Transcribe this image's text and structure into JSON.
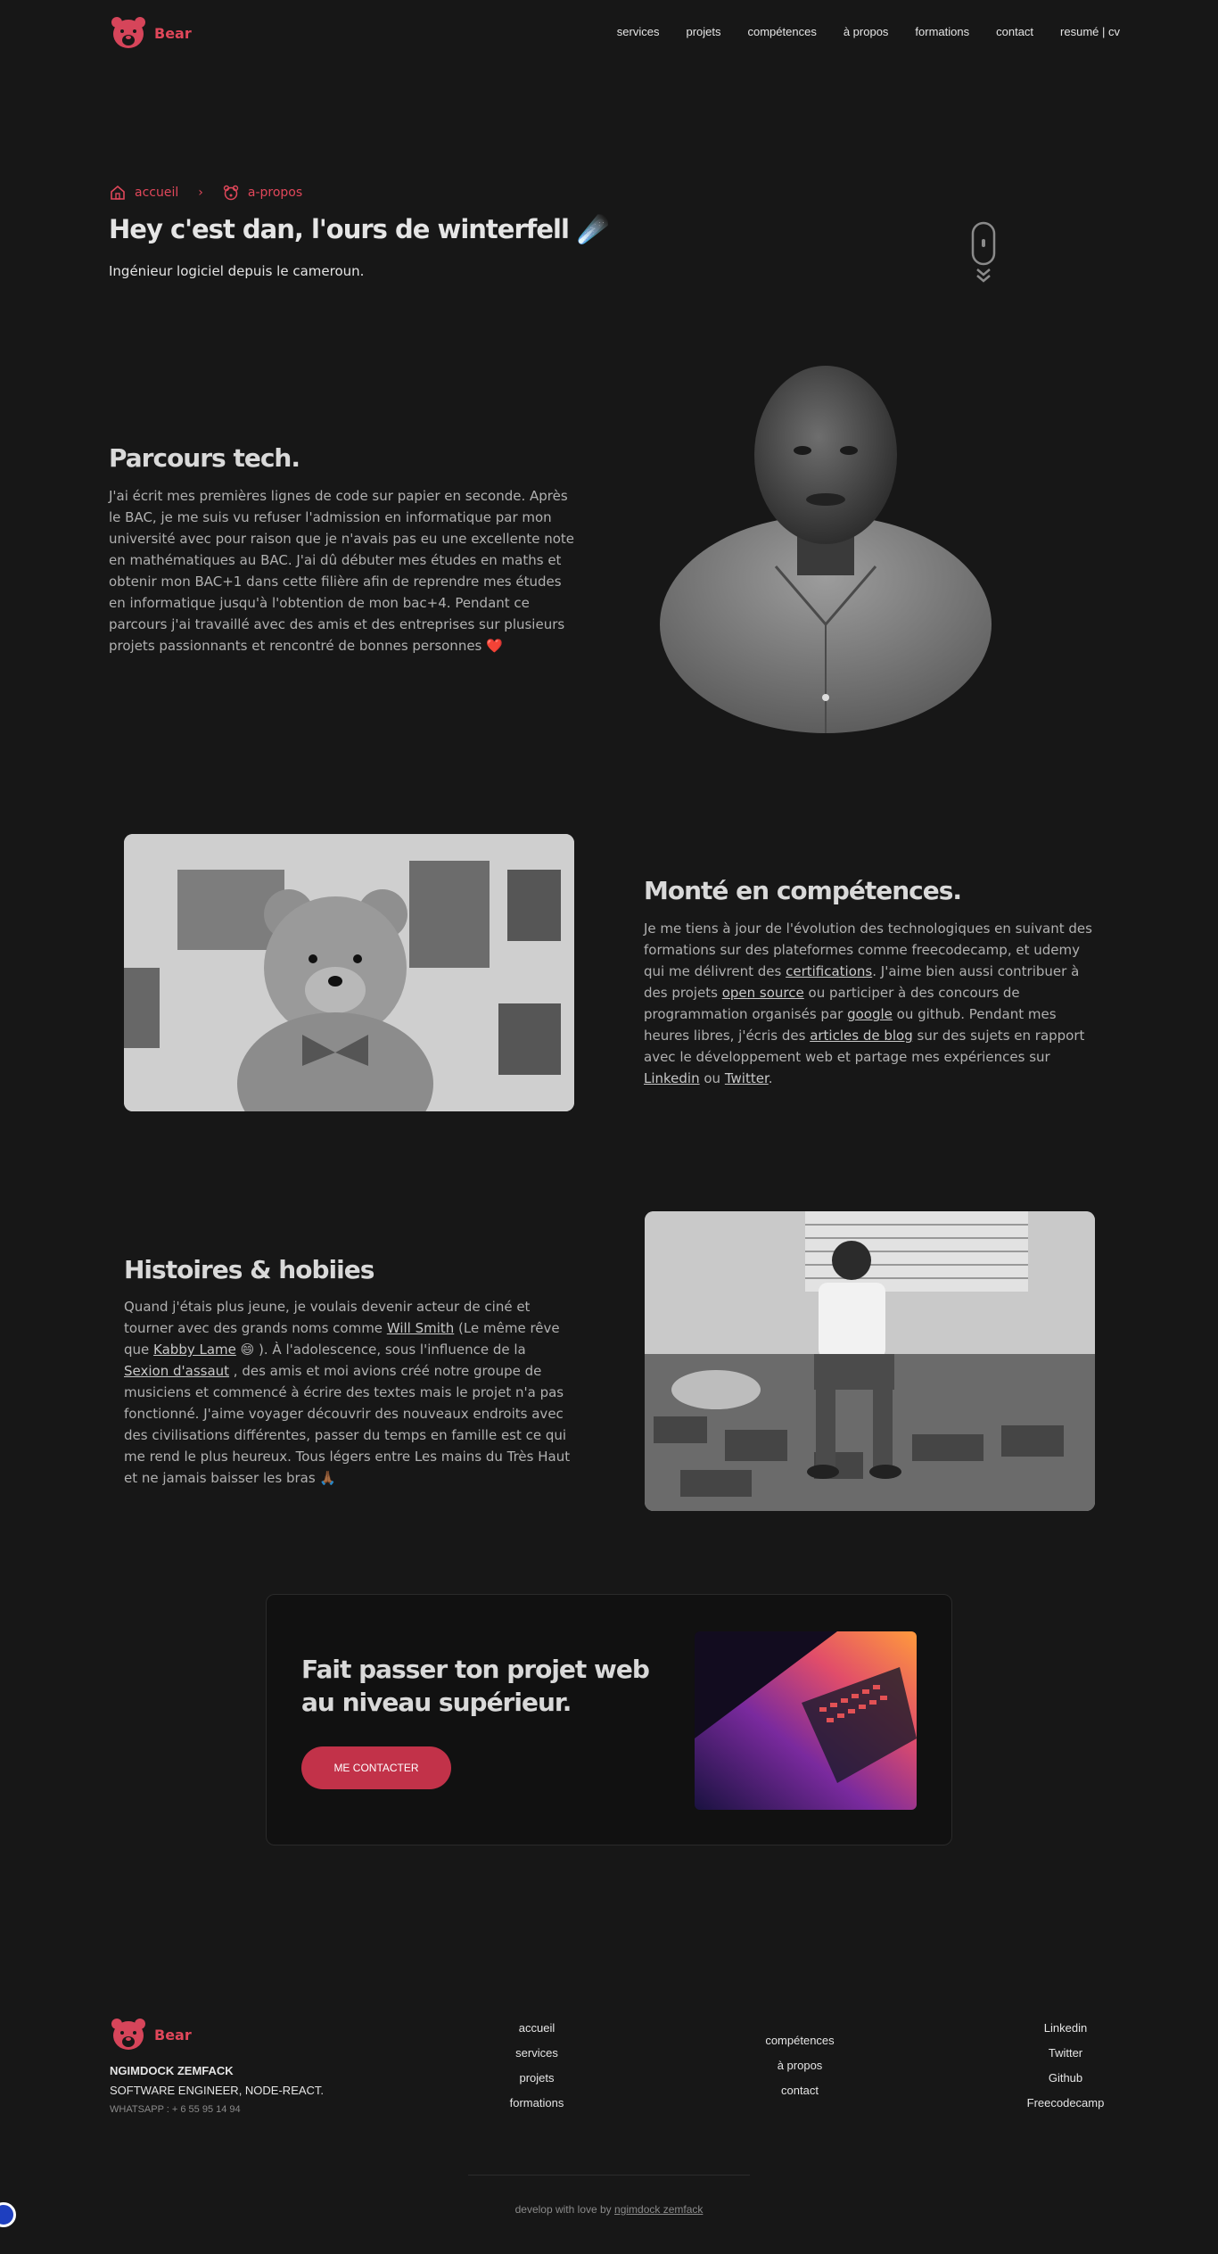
{
  "header": {
    "logo_text": "Bear",
    "nav": [
      "services",
      "projets",
      "compétences",
      "à propos",
      "formations",
      "contact",
      "resumé | cv"
    ]
  },
  "breadcrumb": {
    "home": "accueil",
    "separator": "›",
    "current": "a-propos"
  },
  "hero": {
    "title": "Hey c'est dan, l'ours de winterfell ☄️",
    "subtitle": "Ingénieur logiciel depuis le cameroun."
  },
  "section1": {
    "title": "Parcours tech.",
    "text": "J'ai écrit mes premières lignes de code sur papier en seconde. Après le BAC, je me suis vu refuser l'admission en informatique par mon université avec pour raison que je n'avais pas eu une excellente note en mathématiques au BAC. J'ai dû débuter mes études en maths et obtenir mon BAC+1 dans cette filière afin de reprendre mes études en informatique jusqu'à l'obtention de mon bac+4. Pendant ce parcours j'ai travaillé avec des amis et des entreprises sur plusieurs projets passionnants et rencontré de bonnes personnes ❤️"
  },
  "section2": {
    "title": "Monté en compétences.",
    "t1": "Je me tiens à jour de l'évolution des technologiques en suivant des formations sur des plateformes comme freecodecamp, et udemy qui me délivrent des ",
    "l1": "certifications",
    "t2": ". J'aime bien aussi contribuer à des projets ",
    "l2": "open source",
    "t3": " ou participer à des concours de programmation organisés par ",
    "l3": "google",
    "t4": " ou github. Pendant mes heures libres, j'écris des ",
    "l4": "articles de blog",
    "t5": " sur des sujets en rapport avec le développement web et partage mes expériences sur ",
    "l5": "Linkedin",
    "t6": " ou ",
    "l6": "Twitter",
    "t7": "."
  },
  "section3": {
    "title": "Histoires & hobiies",
    "t1": "Quand j'étais plus jeune, je voulais devenir acteur de ciné et tourner avec des grands noms comme ",
    "l1": "Will Smith",
    "t2": " (Le même rêve que ",
    "l2": "Kabby Lame",
    "t3": " 😄 ). À l'adolescence, sous l'influence de la ",
    "l3": "Sexion d'assaut",
    "t4": " , des amis et moi avions créé notre groupe de musiciens et commencé à écrire des textes mais le projet n'a pas fonctionné. J'aime voyager découvrir des nouveaux endroits avec des civilisations différentes, passer du temps en famille est ce qui me rend le plus heureux. Tous légers entre Les mains du Très Haut et ne jamais baisser les bras 🙏🏾"
  },
  "cta": {
    "title": "Fait passer ton projet web au niveau supérieur.",
    "button": "ME CONTACTER"
  },
  "footer": {
    "logo_text": "Bear",
    "name": "NGIMDOCK ZEMFACK",
    "role": "SOFTWARE ENGINEER, NODE-REACT.",
    "whatsapp": "WHATSAPP : + 6 55 95 14 94",
    "col1": [
      "accueil",
      "services",
      "projets",
      "formations"
    ],
    "col2": [
      "compétences",
      "à propos",
      "contact"
    ],
    "col3": [
      "Linkedin",
      "Twitter",
      "Github",
      "Freecodecamp"
    ],
    "credit_text": "develop with love by ",
    "credit_link": "ngimdock zemfack"
  },
  "colors": {
    "accent": "#e0475a",
    "button": "#c23249",
    "background": "#171717"
  }
}
